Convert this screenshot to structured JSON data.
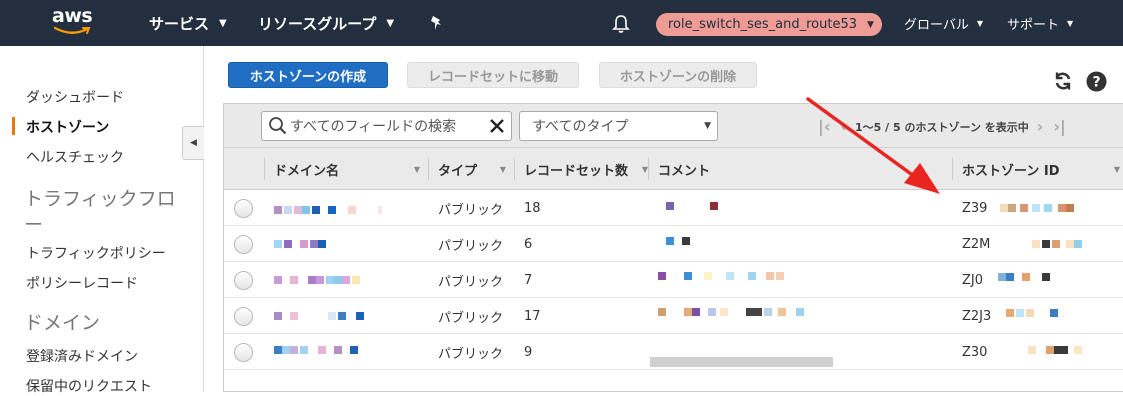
{
  "topbar": {
    "logo_text": "aws",
    "services_label": "サービス",
    "resource_groups_label": "リソースグループ",
    "role_label": "role_switch_ses_and_route53",
    "region_label": "グローバル",
    "support_label": "サポート"
  },
  "sidebar": {
    "items": [
      {
        "label": "ダッシュボード"
      },
      {
        "label": "ホストゾーン",
        "active": true
      },
      {
        "label": "ヘルスチェック"
      }
    ],
    "heading_traffic": "トラフィックフロー",
    "traffic_items": [
      {
        "label": "トラフィックポリシー"
      },
      {
        "label": "ポリシーレコード"
      }
    ],
    "heading_domains": "ドメイン",
    "domain_items": [
      {
        "label": "登録済みドメイン"
      },
      {
        "label": "保留中のリクエスト"
      }
    ]
  },
  "toolbar": {
    "create_label": "ホストゾーンの作成",
    "goto_records_label": "レコードセットに移動",
    "delete_label": "ホストゾーンの削除"
  },
  "filter": {
    "search_placeholder": "すべてのフィールドの検索",
    "type_select_value": "すべてのタイプ",
    "pager_text": "1～5 / 5 のホストゾーン を表示中"
  },
  "table": {
    "columns": [
      "ドメイン名",
      "タイプ",
      "レコードセット数",
      "コメント",
      "ホストゾーン ID"
    ],
    "rows": [
      {
        "type": "パブリック",
        "record_count": "18",
        "id_prefix": "Z39"
      },
      {
        "type": "パブリック",
        "record_count": "6",
        "id_prefix": "Z2M"
      },
      {
        "type": "パブリック",
        "record_count": "7",
        "id_prefix": "ZJ0"
      },
      {
        "type": "パブリック",
        "record_count": "17",
        "id_prefix": "Z2J3"
      },
      {
        "type": "パブリック",
        "record_count": "9",
        "id_prefix": "Z30"
      }
    ]
  },
  "colors": {
    "nav_bg": "#232f3e",
    "primary_button": "#1f6ec4",
    "role_badge": "#ee9c95",
    "active_marker": "#e47911",
    "annotation_arrow": "#e8251f"
  }
}
